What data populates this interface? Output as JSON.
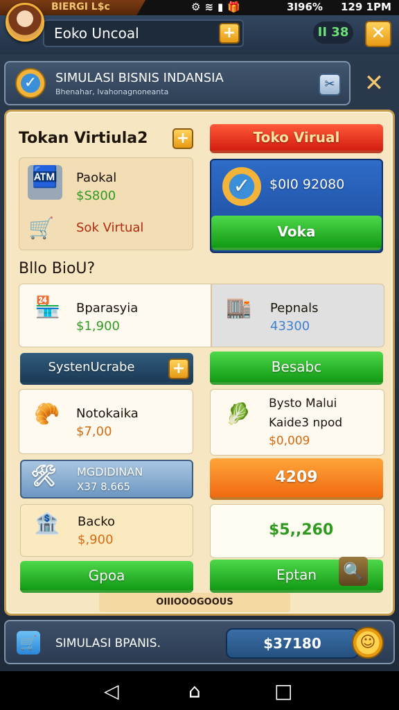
{
  "status_bar": {
    "app_label": "BIERGI L$c",
    "battery": "3I96%",
    "time": "129 1PM"
  },
  "top_bar": {
    "store_name": "Eoko Uncoal",
    "gem_count": "II 38"
  },
  "header": {
    "title": "SIMULASI BISNIS INDANSIA",
    "subtitle": "Bhenahar, Ivahonagnoneanta"
  },
  "section1": {
    "title": "Tokan Virtiula2",
    "card": {
      "name": "Paokal",
      "price": "$S800",
      "sub_label": "Sok Virtual"
    },
    "toko_button": "Toko Virual",
    "balance": "$0I0 92080",
    "voka_button": "Voka"
  },
  "section2": {
    "title": "Bllo BioU?",
    "left_card": {
      "name": "Bparasyia",
      "price": "$1,900"
    },
    "right_card": {
      "name": "Pepnals",
      "price": "43300"
    },
    "upgrade_button": "SystenUcrabe",
    "besabc_button": "Besabc"
  },
  "items": {
    "nokataka": {
      "name": "Notokaika",
      "price": "$7,00"
    },
    "bysto": {
      "name_line1": "Bysto Malui",
      "name_line2": "Kaide3 npod",
      "price": "$0,009"
    },
    "modinan": {
      "name": "MGDIDINAN",
      "sub": "X37 8.665"
    },
    "orange_value": "4209",
    "backo": {
      "name": "Backo",
      "price": "$,900"
    },
    "green_value": "$5,,260"
  },
  "actions": {
    "gpoa": "Gpoa",
    "eptan": "Eptan"
  },
  "footer_text": "OIIIOOOGOOUS",
  "bottom_bar": {
    "label": "SIMULASI BPANIS.",
    "money": "$37180"
  }
}
